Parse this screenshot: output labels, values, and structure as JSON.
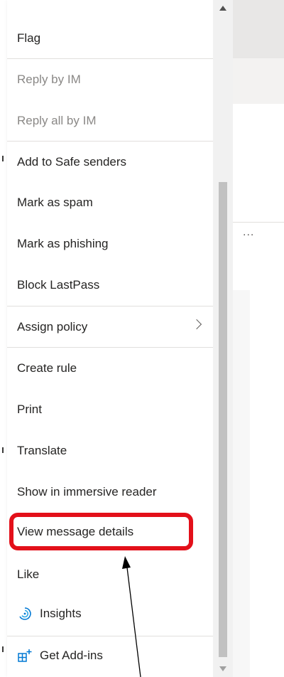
{
  "menu": {
    "items": [
      {
        "label": "Flag",
        "disabled": false
      },
      {
        "label": "Reply by IM",
        "disabled": true
      },
      {
        "label": "Reply all by IM",
        "disabled": true
      },
      {
        "label": "Add to Safe senders",
        "disabled": false
      },
      {
        "label": "Mark as spam",
        "disabled": false
      },
      {
        "label": "Mark as phishing",
        "disabled": false
      },
      {
        "label": "Block LastPass",
        "disabled": false
      },
      {
        "label": "Assign policy",
        "disabled": false,
        "has_submenu": true
      },
      {
        "label": "Create rule",
        "disabled": false
      },
      {
        "label": "Print",
        "disabled": false
      },
      {
        "label": "Translate",
        "disabled": false
      },
      {
        "label": "Show in immersive reader",
        "disabled": false
      },
      {
        "label": "View message details",
        "disabled": false,
        "highlighted": true
      },
      {
        "label": "Like",
        "disabled": false
      },
      {
        "label": "Insights",
        "disabled": false,
        "icon": "insights-icon"
      },
      {
        "label": "Get Add-ins",
        "disabled": false,
        "icon": "add-ins-icon"
      }
    ]
  },
  "background": {
    "more_label": "..."
  },
  "colors": {
    "highlight": "#e3101a",
    "accent": "#0078d4",
    "text": "#252423",
    "disabled_text": "#8a8886"
  }
}
